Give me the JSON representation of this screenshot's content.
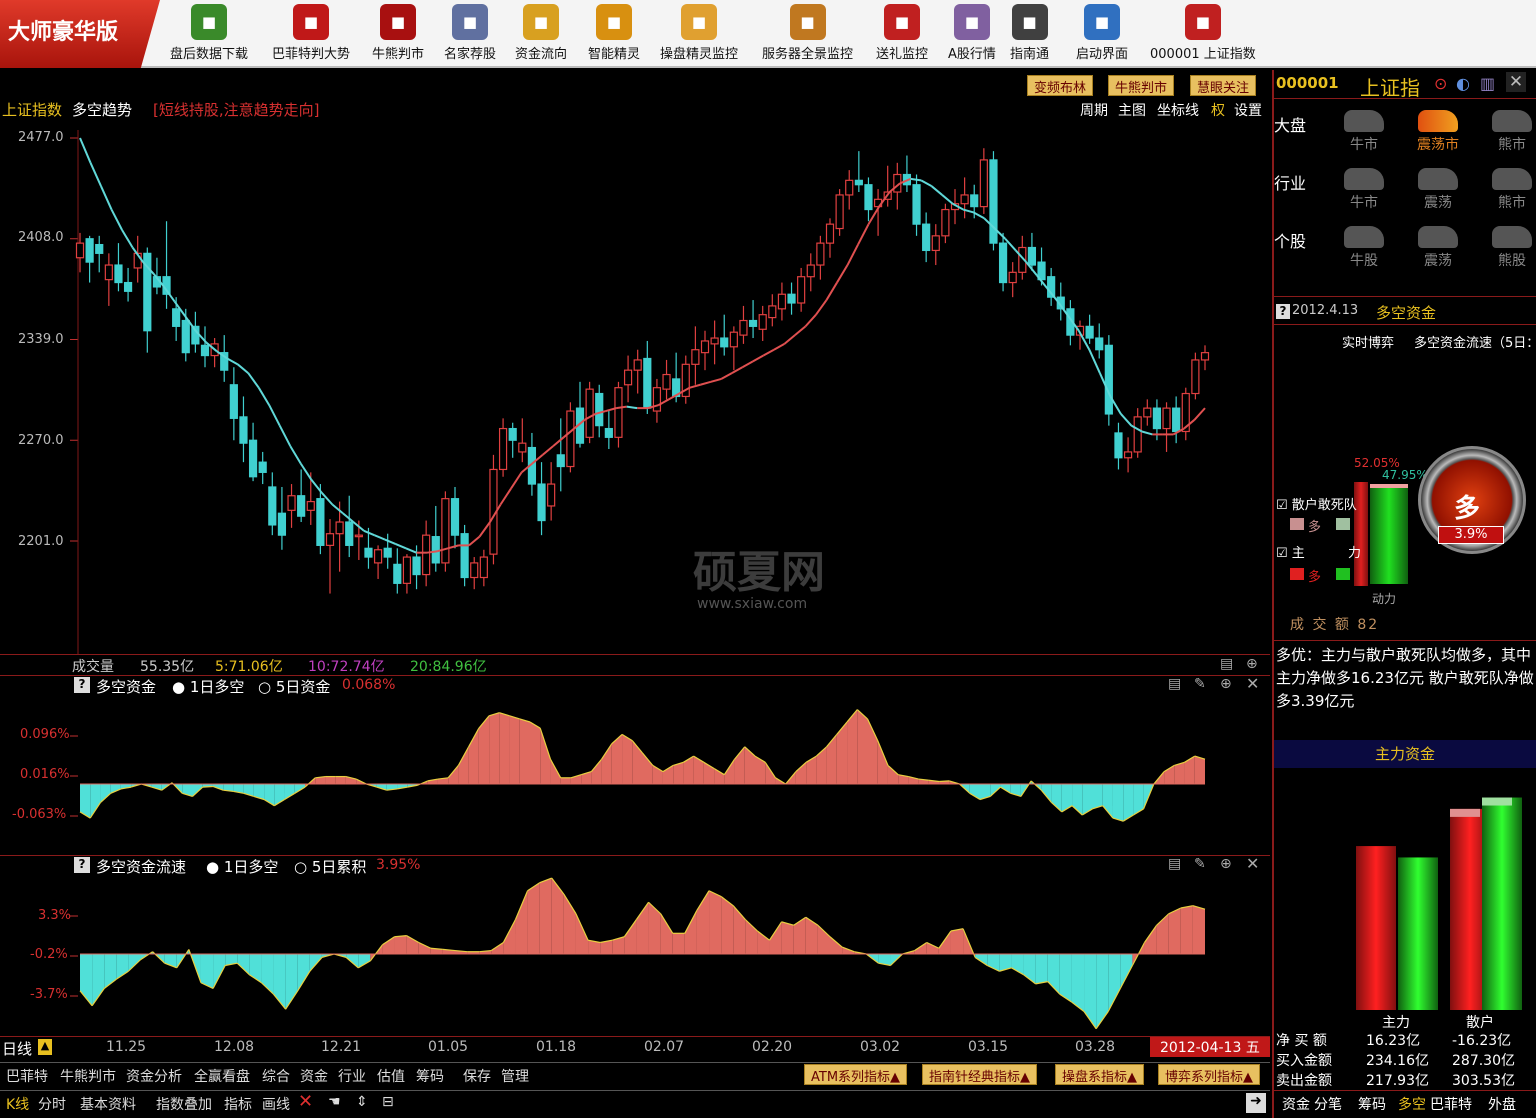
{
  "app": {
    "brand": "大师豪华版"
  },
  "toolbar": [
    {
      "label": "盘后数据下载",
      "icon": "download-icon",
      "color": "#3a8a2a"
    },
    {
      "label": "巴菲特判大势",
      "icon": "buffett-icon",
      "color": "#c01818"
    },
    {
      "label": "牛熊判市",
      "icon": "bull-bear-icon",
      "color": "#a81010"
    },
    {
      "label": "名家荐股",
      "icon": "recommend-icon",
      "color": "#6070a0"
    },
    {
      "label": "资金流向",
      "icon": "money-flow-icon",
      "color": "#d8a020"
    },
    {
      "label": "智能精灵",
      "icon": "genie-icon",
      "color": "#d89010"
    },
    {
      "label": "操盘精灵监控",
      "icon": "trading-monitor-icon",
      "color": "#e0a030"
    },
    {
      "label": "服务器全景监控",
      "icon": "server-monitor-icon",
      "color": "#c07820"
    },
    {
      "label": "送礼监控",
      "icon": "gift-icon",
      "color": "#c02020"
    },
    {
      "label": "A股行情",
      "icon": "a-share-icon",
      "color": "#8060a0"
    },
    {
      "label": "指南通",
      "icon": "guide-icon",
      "color": "#404040"
    },
    {
      "label": "启动界面",
      "icon": "monitor-icon",
      "color": "#3070c0"
    },
    {
      "label": "000001 上证指数",
      "icon": "index-chart-icon",
      "color": "#c02020"
    }
  ],
  "main": {
    "title": "上证指数",
    "subtitle": "多空趋势",
    "hint": "[短线持股,注意趋势走向]",
    "top_buttons": [
      "变频布林",
      "牛熊判市",
      "慧眼关注"
    ],
    "menu": [
      "周期",
      "主图",
      "坐标线",
      "权",
      "设置"
    ],
    "yticks": [
      "2477.0",
      "2408.0",
      "2339.0",
      "2270.0",
      "2201.0"
    ],
    "volume": {
      "label": "成交量",
      "v1": "55.35亿",
      "v5": "5:71.06亿",
      "v10": "10:72.74亿",
      "v20": "20:84.96亿"
    },
    "p2": {
      "title": "多空资金",
      "a": "1日多空",
      "b": "5日资金",
      "val": "0.068%",
      "yticks": [
        "0.096%",
        "0.016%",
        "-0.063%"
      ]
    },
    "p3": {
      "title": "多空资金流速",
      "a": "1日多空",
      "b": "5日累积",
      "val": "3.95%",
      "yticks": [
        "3.3%",
        "-0.2%",
        "-3.7%"
      ]
    },
    "period": "日线",
    "xticks": [
      "11.25",
      "12.08",
      "12.21",
      "01.05",
      "01.18",
      "02.07",
      "02.20",
      "03.02",
      "03.15",
      "03.28"
    ],
    "date": "2012-04-13",
    "weekday": "五"
  },
  "bottom": {
    "row1": [
      "巴菲特",
      "牛熊判市",
      "资金分析",
      "全赢看盘",
      "综合",
      "资金",
      "行业",
      "估值",
      "筹码",
      "保存",
      "管理"
    ],
    "series_buttons": [
      "ATM系列指标",
      "指南针经典指标",
      "操盘系指标",
      "博弈系列指标"
    ],
    "row2": [
      "K线",
      "分时",
      "基本资料",
      "指数叠加",
      "指标",
      "画线"
    ]
  },
  "right": {
    "code": "000001",
    "name": "上证指",
    "rows": [
      {
        "label": "大盘",
        "items": [
          "牛市",
          "震荡市",
          "熊市"
        ]
      },
      {
        "label": "行业",
        "items": [
          "牛市",
          "震荡",
          "熊市"
        ]
      },
      {
        "label": "个股",
        "items": [
          "牛股",
          "震荡",
          "熊股"
        ]
      }
    ],
    "date": "2012.4.13",
    "section": "多空资金",
    "subtitle1": "实时博弈",
    "subtitle2": "多空资金流速（5日：",
    "pct_red": "52.05%",
    "pct_green": "47.95%",
    "chk1": "散户敢死队",
    "chk2": "主",
    "legend_more": "多",
    "legend_li": "力",
    "gauge_text": "多",
    "gauge_val": "3.9%",
    "power": "动力",
    "turnover": "成 交 额 82",
    "comment": "多优：主力与散户敢死队均做多，其中主力净做多16.23亿元 散户敢死队净做多3.39亿元",
    "main_fund": "主力资金",
    "fund_cols": [
      "主力",
      "散户"
    ],
    "fund_rows": [
      {
        "label": "净 买 额",
        "a": "16.23亿",
        "b": "-16.23亿"
      },
      {
        "label": "买入金额",
        "a": "234.16亿",
        "b": "287.30亿"
      },
      {
        "label": "卖出金额",
        "a": "217.93亿",
        "b": "303.53亿"
      }
    ],
    "bottom_tabs": [
      "资金",
      "分笔",
      "筹码",
      "多空",
      "巴菲特",
      "外盘"
    ]
  },
  "watermark": {
    "title": "硕夏网",
    "url": "www.sxiaw.com"
  },
  "chart_data": {
    "type": "candlestick",
    "ylim": [
      2175,
      2480
    ],
    "candles": [
      [
        2395,
        2412,
        2385,
        2405
      ],
      [
        2408,
        2410,
        2378,
        2392
      ],
      [
        2404,
        2410,
        2385,
        2398
      ],
      [
        2380,
        2398,
        2362,
        2390
      ],
      [
        2390,
        2405,
        2372,
        2378
      ],
      [
        2378,
        2388,
        2365,
        2372
      ],
      [
        2388,
        2410,
        2378,
        2398
      ],
      [
        2398,
        2402,
        2330,
        2345
      ],
      [
        2382,
        2395,
        2370,
        2375
      ],
      [
        2382,
        2420,
        2360,
        2370
      ],
      [
        2360,
        2368,
        2338,
        2348
      ],
      [
        2352,
        2360,
        2324,
        2330
      ],
      [
        2348,
        2358,
        2330,
        2336
      ],
      [
        2335,
        2348,
        2320,
        2328
      ],
      [
        2328,
        2340,
        2320,
        2336
      ],
      [
        2330,
        2342,
        2310,
        2318
      ],
      [
        2308,
        2320,
        2270,
        2285
      ],
      [
        2286,
        2300,
        2255,
        2268
      ],
      [
        2270,
        2282,
        2242,
        2245
      ],
      [
        2255,
        2262,
        2240,
        2248
      ],
      [
        2238,
        2248,
        2205,
        2212
      ],
      [
        2220,
        2238,
        2195,
        2205
      ],
      [
        2222,
        2240,
        2210,
        2232
      ],
      [
        2232,
        2250,
        2214,
        2218
      ],
      [
        2222,
        2248,
        2212,
        2228
      ],
      [
        2230,
        2240,
        2192,
        2198
      ],
      [
        2198,
        2216,
        2165,
        2206
      ],
      [
        2206,
        2228,
        2180,
        2214
      ],
      [
        2214,
        2232,
        2190,
        2198
      ],
      [
        2204,
        2215,
        2188,
        2205
      ],
      [
        2196,
        2210,
        2182,
        2190
      ],
      [
        2186,
        2198,
        2175,
        2195
      ],
      [
        2196,
        2206,
        2182,
        2190
      ],
      [
        2185,
        2196,
        2165,
        2172
      ],
      [
        2172,
        2192,
        2165,
        2190
      ],
      [
        2190,
        2198,
        2168,
        2178
      ],
      [
        2178,
        2215,
        2170,
        2205
      ],
      [
        2204,
        2225,
        2180,
        2186
      ],
      [
        2186,
        2235,
        2180,
        2230
      ],
      [
        2230,
        2238,
        2196,
        2205
      ],
      [
        2206,
        2212,
        2170,
        2176
      ],
      [
        2176,
        2190,
        2168,
        2186
      ],
      [
        2176,
        2195,
        2170,
        2190
      ],
      [
        2192,
        2260,
        2185,
        2250
      ],
      [
        2250,
        2285,
        2245,
        2278
      ],
      [
        2278,
        2282,
        2258,
        2270
      ],
      [
        2262,
        2285,
        2255,
        2268
      ],
      [
        2265,
        2275,
        2232,
        2240
      ],
      [
        2240,
        2255,
        2205,
        2215
      ],
      [
        2225,
        2255,
        2215,
        2240
      ],
      [
        2260,
        2285,
        2235,
        2252
      ],
      [
        2252,
        2296,
        2248,
        2290
      ],
      [
        2292,
        2310,
        2265,
        2268
      ],
      [
        2272,
        2310,
        2268,
        2305
      ],
      [
        2302,
        2308,
        2272,
        2280
      ],
      [
        2278,
        2290,
        2264,
        2272
      ],
      [
        2272,
        2310,
        2265,
        2306
      ],
      [
        2308,
        2328,
        2296,
        2318
      ],
      [
        2318,
        2332,
        2302,
        2325
      ],
      [
        2326,
        2338,
        2288,
        2292
      ],
      [
        2290,
        2312,
        2282,
        2306
      ],
      [
        2305,
        2325,
        2298,
        2315
      ],
      [
        2312,
        2330,
        2296,
        2300
      ],
      [
        2300,
        2328,
        2295,
        2322
      ],
      [
        2322,
        2348,
        2308,
        2332
      ],
      [
        2330,
        2345,
        2318,
        2338
      ],
      [
        2336,
        2352,
        2322,
        2340
      ],
      [
        2340,
        2356,
        2328,
        2334
      ],
      [
        2334,
        2348,
        2318,
        2344
      ],
      [
        2342,
        2362,
        2336,
        2352
      ],
      [
        2352,
        2366,
        2340,
        2348
      ],
      [
        2346,
        2362,
        2338,
        2356
      ],
      [
        2354,
        2370,
        2348,
        2362
      ],
      [
        2360,
        2378,
        2352,
        2370
      ],
      [
        2370,
        2378,
        2356,
        2364
      ],
      [
        2364,
        2388,
        2358,
        2382
      ],
      [
        2382,
        2398,
        2372,
        2390
      ],
      [
        2390,
        2410,
        2380,
        2405
      ],
      [
        2405,
        2422,
        2395,
        2418
      ],
      [
        2415,
        2442,
        2410,
        2438
      ],
      [
        2438,
        2455,
        2428,
        2448
      ],
      [
        2448,
        2468,
        2440,
        2445
      ],
      [
        2445,
        2450,
        2420,
        2428
      ],
      [
        2430,
        2442,
        2410,
        2435
      ],
      [
        2435,
        2458,
        2430,
        2440
      ],
      [
        2440,
        2460,
        2428,
        2452
      ],
      [
        2452,
        2465,
        2440,
        2445
      ],
      [
        2445,
        2452,
        2410,
        2418
      ],
      [
        2418,
        2426,
        2392,
        2400
      ],
      [
        2400,
        2418,
        2390,
        2410
      ],
      [
        2410,
        2432,
        2405,
        2428
      ],
      [
        2428,
        2442,
        2418,
        2432
      ],
      [
        2432,
        2450,
        2422,
        2438
      ],
      [
        2438,
        2445,
        2422,
        2430
      ],
      [
        2430,
        2470,
        2425,
        2462
      ],
      [
        2462,
        2468,
        2400,
        2405
      ],
      [
        2405,
        2412,
        2372,
        2378
      ],
      [
        2378,
        2392,
        2368,
        2385
      ],
      [
        2385,
        2410,
        2380,
        2402
      ],
      [
        2402,
        2412,
        2386,
        2390
      ],
      [
        2392,
        2402,
        2376,
        2380
      ],
      [
        2382,
        2388,
        2362,
        2368
      ],
      [
        2368,
        2378,
        2352,
        2360
      ],
      [
        2360,
        2366,
        2335,
        2342
      ],
      [
        2342,
        2352,
        2332,
        2348
      ],
      [
        2348,
        2356,
        2336,
        2340
      ],
      [
        2340,
        2350,
        2326,
        2332
      ],
      [
        2335,
        2342,
        2280,
        2288
      ],
      [
        2275,
        2282,
        2250,
        2258
      ],
      [
        2258,
        2272,
        2248,
        2262
      ],
      [
        2262,
        2292,
        2258,
        2286
      ],
      [
        2286,
        2298,
        2280,
        2292
      ],
      [
        2292,
        2298,
        2270,
        2278
      ],
      [
        2278,
        2296,
        2262,
        2292
      ],
      [
        2292,
        2300,
        2268,
        2276
      ],
      [
        2276,
        2306,
        2270,
        2302
      ],
      [
        2302,
        2330,
        2298,
        2325
      ],
      [
        2325,
        2335,
        2318,
        2330
      ]
    ],
    "ma": [
      2477,
      2460,
      2444,
      2428,
      2414,
      2402,
      2392,
      2384,
      2375,
      2365,
      2355,
      2345,
      2337,
      2331,
      2326,
      2322,
      2316,
      2306,
      2294,
      2280,
      2266,
      2254,
      2243,
      2234,
      2226,
      2220,
      2214,
      2208,
      2205,
      2202,
      2199,
      2196,
      2193,
      2193,
      2194,
      2196,
      2198,
      2198,
      2204,
      2214,
      2226,
      2237,
      2248,
      2254,
      2260,
      2266,
      2272,
      2278,
      2284,
      2288,
      2290,
      2292,
      2293,
      2292,
      2292,
      2294,
      2298,
      2302,
      2306,
      2308,
      2310,
      2312,
      2316,
      2320,
      2324,
      2328,
      2332,
      2336,
      2342,
      2348,
      2356,
      2366,
      2378,
      2390,
      2404,
      2418,
      2430,
      2440,
      2446,
      2449,
      2448,
      2444,
      2438,
      2432,
      2428,
      2426,
      2422,
      2415,
      2408,
      2400,
      2392,
      2383,
      2374,
      2365,
      2355,
      2345,
      2332,
      2316,
      2300,
      2288,
      2280,
      2276,
      2274,
      2274,
      2274,
      2278,
      2284,
      2292
    ],
    "fund": [
      -0.045,
      -0.055,
      -0.03,
      -0.015,
      -0.008,
      -0.005,
      0.0,
      -0.005,
      -0.01,
      0.002,
      -0.015,
      -0.02,
      -0.005,
      -0.004,
      -0.01,
      -0.012,
      -0.015,
      -0.02,
      -0.025,
      -0.035,
      -0.025,
      -0.015,
      -0.005,
      0.01,
      0.012,
      0.012,
      0.012,
      0.008,
      0.0,
      -0.005,
      -0.01,
      -0.008,
      -0.005,
      -0.002,
      0.005,
      0.008,
      0.01,
      0.03,
      0.06,
      0.09,
      0.11,
      0.115,
      0.11,
      0.105,
      0.1,
      0.09,
      0.04,
      0.01,
      0.01,
      0.015,
      0.02,
      0.04,
      0.065,
      0.08,
      0.07,
      0.05,
      0.03,
      0.02,
      0.03,
      0.035,
      0.045,
      0.035,
      0.025,
      0.015,
      0.04,
      0.06,
      0.045,
      0.035,
      0.01,
      0.0,
      0.02,
      0.035,
      0.045,
      0.06,
      0.08,
      0.1,
      0.12,
      0.105,
      0.07,
      0.03,
      0.015,
      0.012,
      0.008,
      0.006,
      0.004,
      0.005,
      0.0,
      -0.015,
      -0.025,
      -0.02,
      -0.005,
      -0.015,
      -0.02,
      0.005,
      -0.01,
      -0.03,
      -0.045,
      -0.035,
      -0.05,
      -0.04,
      -0.035,
      -0.055,
      -0.06,
      -0.05,
      -0.04,
      0.0,
      0.02,
      0.03,
      0.035,
      0.045,
      0.04
    ],
    "flow": [
      -3.2,
      -4.5,
      -3.0,
      -2.2,
      -1.5,
      -0.5,
      0.2,
      -0.8,
      -1.2,
      0.4,
      -2.5,
      -3.0,
      -1.0,
      -0.8,
      -1.8,
      -2.5,
      -3.5,
      -4.8,
      -3.2,
      -1.5,
      -0.3,
      0.0,
      -0.3,
      -1.2,
      -0.6,
      0.8,
      1.5,
      1.6,
      1.0,
      0.5,
      0.4,
      0.3,
      0.2,
      0.2,
      0.3,
      1.0,
      3.0,
      5.5,
      6.2,
      6.6,
      5.2,
      3.5,
      1.2,
      1.0,
      1.2,
      1.5,
      3.0,
      4.5,
      3.5,
      1.8,
      1.8,
      3.8,
      5.5,
      5.0,
      4.2,
      3.0,
      2.0,
      1.2,
      2.8,
      2.5,
      3.2,
      2.5,
      1.5,
      0.6,
      0.2,
      0.0,
      -0.8,
      -1.0,
      0.0,
      0.3,
      1.0,
      0.5,
      2.0,
      2.2,
      -0.3,
      -1.0,
      -1.5,
      -1.2,
      -1.8,
      -2.6,
      -2.4,
      -3.5,
      -4.2,
      -5.0,
      -6.5,
      -5.0,
      -3.0,
      -1.0,
      1.0,
      2.5,
      3.5,
      4.0,
      4.2,
      3.9
    ]
  }
}
